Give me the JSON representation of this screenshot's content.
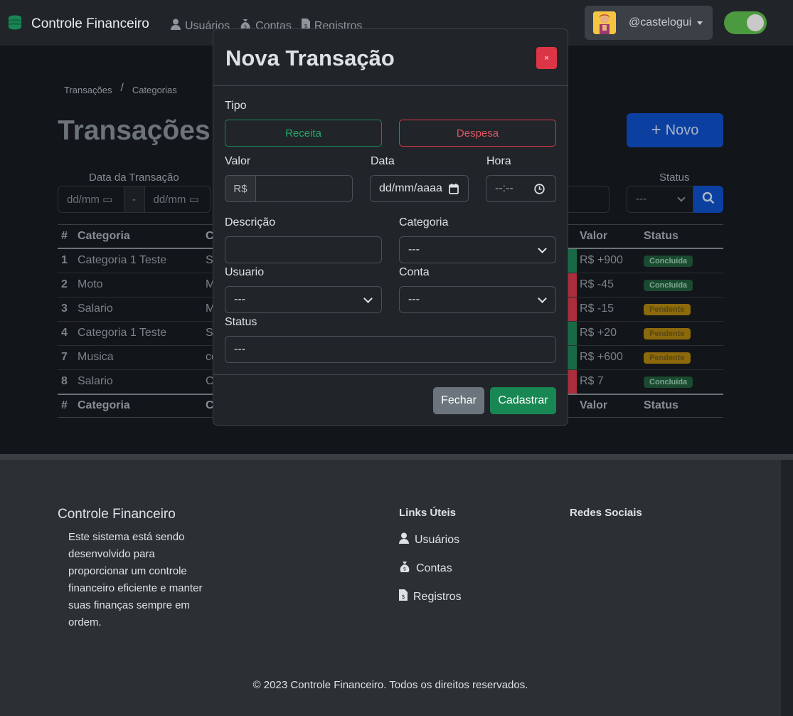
{
  "navbar": {
    "brand": "Controle Financeiro",
    "links": [
      {
        "label": "Usuários",
        "icon": "user-icon"
      },
      {
        "label": "Contas",
        "icon": "money-bag-icon"
      },
      {
        "label": "Registros",
        "icon": "file-invoice-icon"
      }
    ],
    "username": "@castelogui"
  },
  "page": {
    "breadcrumb": [
      "Transações",
      "Categorias"
    ],
    "breadcrumb_sep": "/",
    "title": "Transações",
    "new_button": "Novo",
    "filters": {
      "date_label": "Data da Transação",
      "date_from_placeholder": "dd/mm",
      "date_sep": "-",
      "date_to_placeholder": "dd/mm",
      "status_label": "Status",
      "status_value": "---"
    },
    "table": {
      "headers": [
        "#",
        "Categoria",
        "C",
        "Valor",
        "Status"
      ],
      "rows": [
        {
          "id": "1",
          "categoria": "Categoria 1 Teste",
          "desc": "Sa",
          "kind": "receita",
          "valor": "R$ +900",
          "status": "Concluída",
          "status_kind": "done"
        },
        {
          "id": "2",
          "categoria": "Moto",
          "desc": "M",
          "kind": "despesa",
          "valor": "R$ -45",
          "status": "Concluída",
          "status_kind": "done"
        },
        {
          "id": "3",
          "categoria": "Salario",
          "desc": "M",
          "kind": "despesa",
          "valor": "R$ -15",
          "status": "Pendente",
          "status_kind": "pend"
        },
        {
          "id": "4",
          "categoria": "Categoria 1 Teste",
          "desc": "Sa",
          "kind": "receita",
          "valor": "R$ +20",
          "status": "Pendente",
          "status_kind": "pend"
        },
        {
          "id": "7",
          "categoria": "Musica",
          "desc": "co",
          "kind": "receita",
          "valor": "R$ +600",
          "status": "Pendente",
          "status_kind": "pend"
        },
        {
          "id": "8",
          "categoria": "Salario",
          "desc": "C",
          "kind": "despesa",
          "valor": "R$ 7",
          "status": "Concluída",
          "status_kind": "done"
        }
      ]
    }
  },
  "modal": {
    "title": "Nova Transação",
    "close_label": "×",
    "tipo_label": "Tipo",
    "tipo_receita": "Receita",
    "tipo_despesa": "Despesa",
    "valor_label": "Valor",
    "valor_prefix": "R$",
    "valor_value": "",
    "data_label": "Data",
    "data_placeholder": "dd/mm/aaaa",
    "hora_label": "Hora",
    "hora_placeholder": "--:--",
    "descricao_label": "Descrição",
    "descricao_value": "",
    "categoria_label": "Categoria",
    "categoria_value": "---",
    "usuario_label": "Usuario",
    "usuario_value": "---",
    "conta_label": "Conta",
    "conta_value": "---",
    "status_label": "Status",
    "status_value": "---",
    "fechar": "Fechar",
    "cadastrar": "Cadastrar"
  },
  "footer": {
    "title": "Controle Financeiro",
    "description": "Este sistema está sendo desenvolvido para proporcionar um controle financeiro eficiente e manter suas finanças sempre em ordem.",
    "links_title": "Links Úteis",
    "links": [
      {
        "label": "Usuários",
        "icon": "user-icon"
      },
      {
        "label": "Contas",
        "icon": "money-bag-icon"
      },
      {
        "label": "Registros",
        "icon": "file-invoice-icon"
      }
    ],
    "social_title": "Redes Sociais",
    "copyright": "© 2023 Controle Financeiro. Todos os direitos reservados."
  },
  "colors": {
    "receita": "#198754",
    "despesa": "#dc3545",
    "primary": "#0d6efd",
    "badge_done": "#1a4a30",
    "badge_pend": "#8c6a0c"
  }
}
